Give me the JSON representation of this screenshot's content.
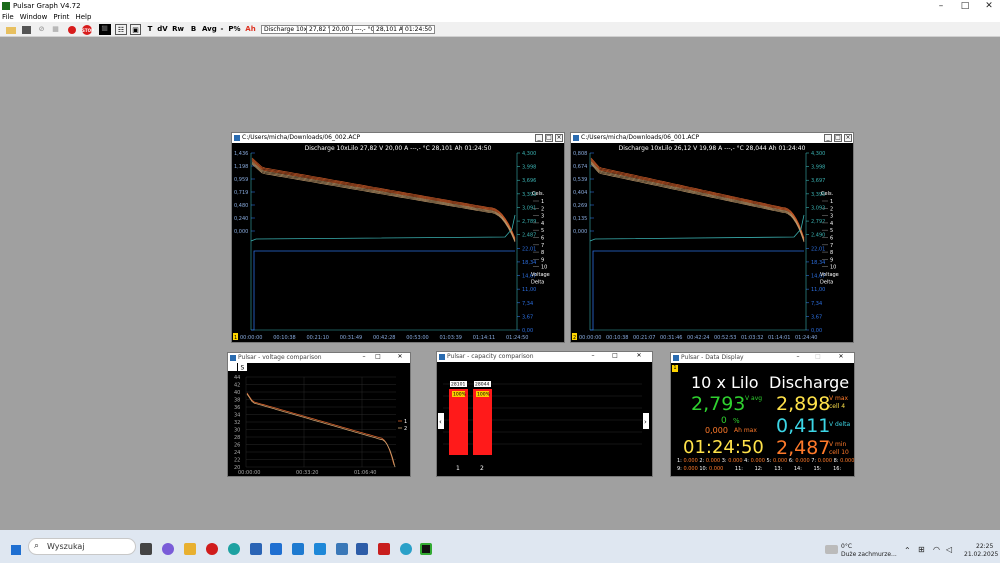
{
  "window": {
    "title": "Pulsar Graph V4.72"
  },
  "menu": [
    "File",
    "Window",
    "Print",
    "Help"
  ],
  "toolbar": {
    "labels": [
      "T",
      "dV",
      "Rw",
      "B",
      "Avg",
      "-",
      "P%",
      "Ah"
    ],
    "status_boxes": [
      "Discharge 10xLilo",
      "27,82 V",
      "20,00 A",
      "---,- °C",
      "28,101 Ah",
      "01:24:50"
    ]
  },
  "graph_left": {
    "caption": "C:/Users/micha/Downloads/06_002.ACP",
    "header": "Discharge 10xLilo   27,82 V   20,00 A   ---,- °C   28,101 Ah   01:24:50",
    "left_ticks": [
      "1,436",
      "1,198",
      "0,959",
      "0,719",
      "0,480",
      "0,240",
      "0,000"
    ],
    "right_ticks": [
      "4,300",
      "3,998",
      "3,696",
      "3,393",
      "3,091",
      "2,789",
      "2,487",
      "22,01",
      "18,34",
      "14,67",
      "11,00",
      "7,34",
      "3,67",
      "0,00"
    ],
    "x_ticks": [
      "00:00:00",
      "00:10:38",
      "00:21:10",
      "00:31:49",
      "00:42:28",
      "00:53:00",
      "01:03:39",
      "01:14:11",
      "01:24:50"
    ],
    "legend_title": "Cels.",
    "legend": [
      "1",
      "2",
      "3",
      "4",
      "5",
      "6",
      "7",
      "8",
      "9",
      "10",
      "Voltage",
      "Delta"
    ],
    "marker": "1"
  },
  "graph_right": {
    "caption": "C:/Users/micha/Downloads/06_001.ACP",
    "header": "Discharge 10xLilo   26,12 V   19,98 A   ---,- °C   28,044 Ah   01:24:40",
    "left_ticks": [
      "0,808",
      "0,674",
      "0,539",
      "0,404",
      "0,269",
      "0,135",
      "0,000"
    ],
    "right_ticks": [
      "4,300",
      "3,998",
      "3,697",
      "3,395",
      "3,093",
      "2,792",
      "2,490",
      "22,01",
      "18,34",
      "14,67",
      "11,00",
      "7,34",
      "3,67",
      "0,00"
    ],
    "x_ticks": [
      "00:00:00",
      "00:10:38",
      "00:21:07",
      "00:31:46",
      "00:42:24",
      "00:52:53",
      "01:03:32",
      "01:14:01",
      "01:24:40"
    ],
    "legend_title": "Cels.",
    "legend": [
      "1",
      "2",
      "3",
      "4",
      "5",
      "6",
      "7",
      "8",
      "9",
      "10",
      "Voltage",
      "Delta"
    ],
    "marker": "2"
  },
  "voltage_window": {
    "caption": "Pulsar - voltage comparison",
    "y_ticks": [
      "44",
      "42",
      "40",
      "38",
      "36",
      "34",
      "32",
      "30",
      "28",
      "26",
      "24",
      "22",
      "20"
    ],
    "x_ticks": [
      "00:00:00",
      "00:33:20",
      "01:06:40"
    ],
    "legend": [
      "1",
      "2"
    ],
    "btn_s": "S"
  },
  "capacity_window": {
    "caption": "Pulsar - capacity comparison",
    "bars": [
      {
        "label": "1",
        "value_text": "28101",
        "pct": "100%"
      },
      {
        "label": "2",
        "value_text": "28044",
        "pct": "100%"
      }
    ]
  },
  "data_window": {
    "caption": "Pulsar - Data Display",
    "marker": "1",
    "cells_label": "10 x Lilo",
    "mode": "Discharge",
    "v_avg": "2,793",
    "v_avg_label": "V avg",
    "v_max": "2,898",
    "v_max_label": "V max",
    "v_max_cell": "cell 4",
    "pct_value": "0",
    "pct_unit": "%",
    "ah_max_value": "0,000",
    "ah_max_label": "Ah max",
    "v_delta": "0,411",
    "v_delta_label": "V delta",
    "time": "01:24:50",
    "v_min": "2,487",
    "v_min_label": "V min",
    "v_min_cell": "cell 10",
    "cells_row1": [
      "1:",
      "0.000",
      "2:",
      "0.000",
      "3:",
      "0.000",
      "4:",
      "0.000",
      "5:",
      "0.000",
      "6:",
      "0.000",
      "7:",
      "0.000",
      "8:",
      "0.000"
    ],
    "cells_row2": [
      "9:",
      "0.000",
      "10:",
      "0.000",
      "11:",
      "12:",
      "13:",
      "14:",
      "15:",
      "16:"
    ]
  },
  "taskbar": {
    "search_placeholder": "Wyszukaj",
    "weather_temp": "0°C",
    "weather_text": "Duże zachmurze...",
    "time": "22:25",
    "date": "21.02.2025"
  },
  "colors": {
    "curve_orange": "#d9622b",
    "curve_tan": "#c8a070",
    "delta": "#3ab0b0",
    "voltage": "#2c6fe0",
    "avg_green": "#2fd12f",
    "max_yellow": "#ffe24a",
    "delta_cyan": "#3cd6e6",
    "min_orange": "#ff7a2a",
    "bar_red": "#ff1a1a"
  }
}
